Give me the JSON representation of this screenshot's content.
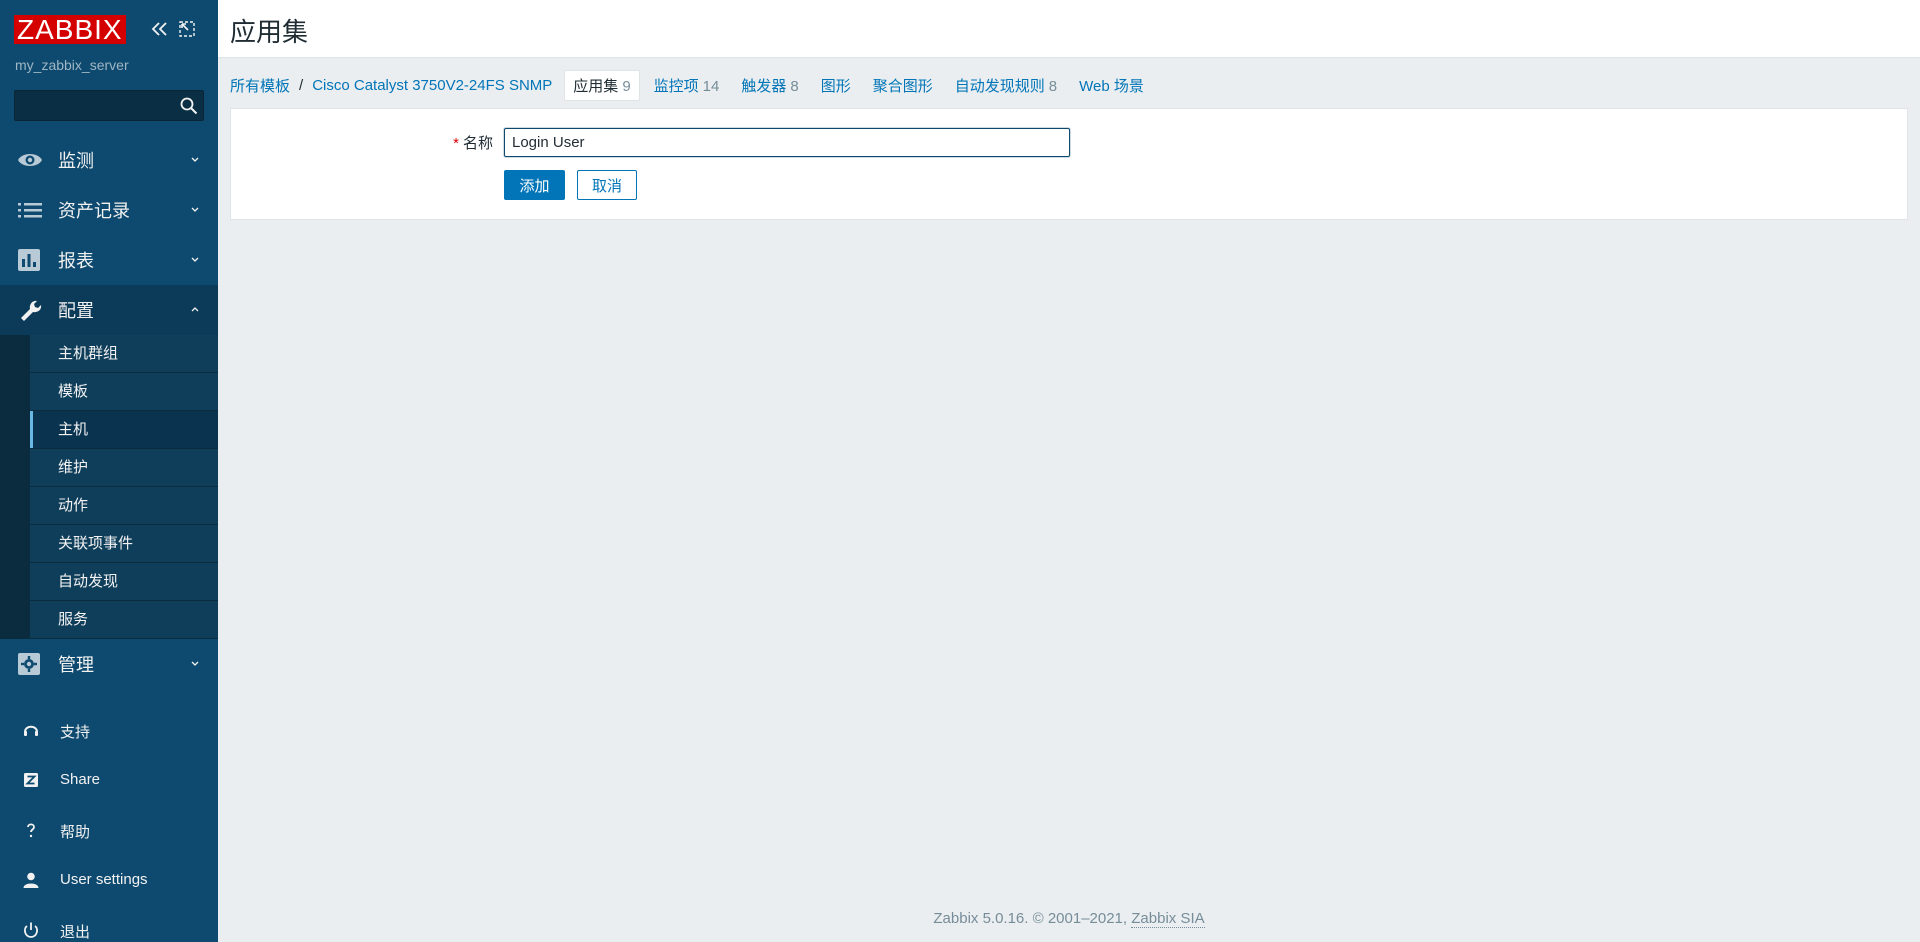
{
  "sidebar": {
    "logo": "ZABBIX",
    "server_name": "my_zabbix_server",
    "search_placeholder": "",
    "menu": [
      {
        "label": "监测",
        "icon": "eye-icon"
      },
      {
        "label": "资产记录",
        "icon": "list-icon"
      },
      {
        "label": "报表",
        "icon": "bar-chart-icon"
      },
      {
        "label": "配置",
        "icon": "wrench-icon"
      }
    ],
    "submenu": [
      "主机群组",
      "模板",
      "主机",
      "维护",
      "动作",
      "关联项事件",
      "自动发现",
      "服务"
    ],
    "admin_label": "管理",
    "bottom": [
      {
        "label": "支持",
        "icon": "headset-icon"
      },
      {
        "label": "Share",
        "icon": "share-icon"
      },
      {
        "label": "帮助",
        "icon": "help-icon"
      },
      {
        "label": "User settings",
        "icon": "user-icon"
      },
      {
        "label": "退出",
        "icon": "power-icon"
      }
    ]
  },
  "header": {
    "title": "应用集"
  },
  "nav": {
    "all_templates": "所有模板",
    "separator": "/",
    "template_name": "Cisco Catalyst 3750V2-24FS SNMP",
    "tabs": [
      {
        "label": "应用集",
        "count": "9"
      },
      {
        "label": "监控项",
        "count": "14"
      },
      {
        "label": "触发器",
        "count": "8"
      },
      {
        "label": "图形",
        "count": ""
      },
      {
        "label": "聚合图形",
        "count": ""
      },
      {
        "label": "自动发现规则",
        "count": "8"
      },
      {
        "label": "Web 场景",
        "count": ""
      }
    ]
  },
  "form": {
    "required_mark": "*",
    "name_label": "名称",
    "name_value": "Login User",
    "add_button": "添加",
    "cancel_button": "取消"
  },
  "footer": {
    "text": "Zabbix 5.0.16. © 2001–2021, ",
    "vendor": "Zabbix SIA"
  }
}
